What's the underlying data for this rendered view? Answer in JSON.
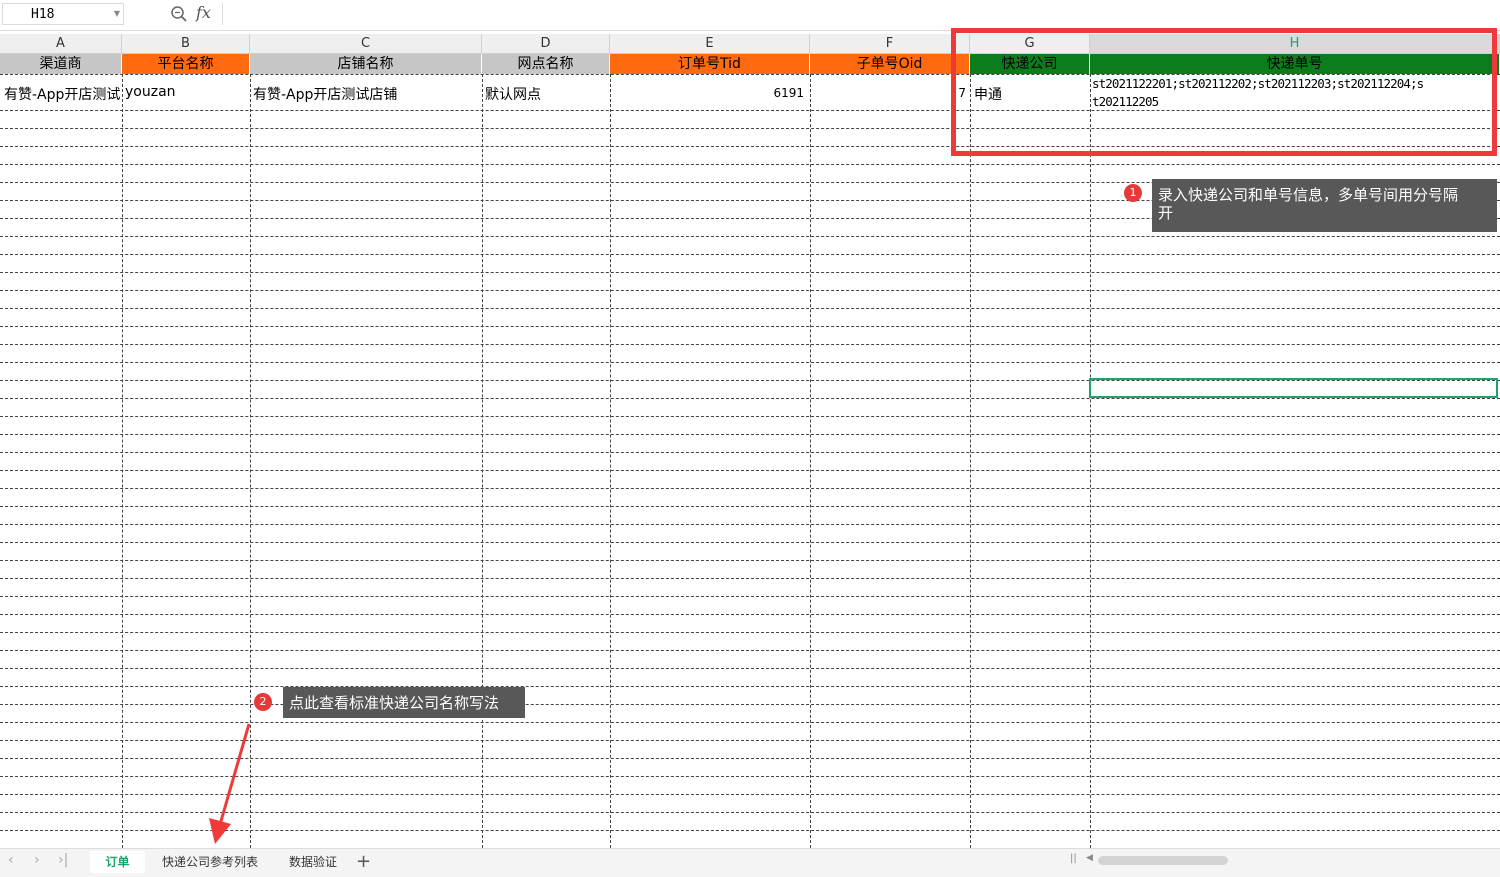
{
  "formula_bar": {
    "cell_ref": "H18",
    "fx": "fx"
  },
  "columns": [
    {
      "letter": "A",
      "header": "渠道商",
      "header_bg": "#c6c6c6",
      "header_color": "#000000"
    },
    {
      "letter": "B",
      "header": "平台名称",
      "header_bg": "#ff6a10",
      "header_color": "#000000"
    },
    {
      "letter": "C",
      "header": "店铺名称",
      "header_bg": "#c6c6c6",
      "header_color": "#000000"
    },
    {
      "letter": "D",
      "header": "网点名称",
      "header_bg": "#c6c6c6",
      "header_color": "#000000"
    },
    {
      "letter": "E",
      "header": "订单号Tid",
      "header_bg": "#ff6a10",
      "header_color": "#000000"
    },
    {
      "letter": "F",
      "header": "子单号Oid",
      "header_bg": "#ff6a10",
      "header_color": "#000000"
    },
    {
      "letter": "G",
      "header": "快递公司",
      "header_bg": "#0b7d1d",
      "header_color": "#000000"
    },
    {
      "letter": "H",
      "header": "快递单号",
      "header_bg": "#0b7d1d",
      "header_color": "#000000"
    }
  ],
  "row1": {
    "a": "有赞-App开店测试",
    "b": "youzan",
    "c": "有赞-App开店测试店铺",
    "d": "默认网点",
    "e": "6191",
    "f": "7",
    "g": "申通",
    "h_line1": "st2021122201;st202112202;st202112203;st202112204;s",
    "h_line2": "t202112205"
  },
  "annotations": {
    "tip1_number": "1",
    "tip1_line1": "录入快递公司和单号信息，多单号间用分号隔",
    "tip1_line2": "开",
    "tip2_number": "2",
    "tip2_text": "点此查看标准快递公司名称写法",
    "highlight_color": "#ef3a3a"
  },
  "sheet_tabs": [
    {
      "label": "订单",
      "active": true
    },
    {
      "label": "快递公司参考列表",
      "active": false
    },
    {
      "label": "数据验证",
      "active": false
    }
  ],
  "tab_nav": {
    "first": "‹",
    "next": "›",
    "last": "›|",
    "add": "+"
  },
  "accent_color": "#1fa36b"
}
